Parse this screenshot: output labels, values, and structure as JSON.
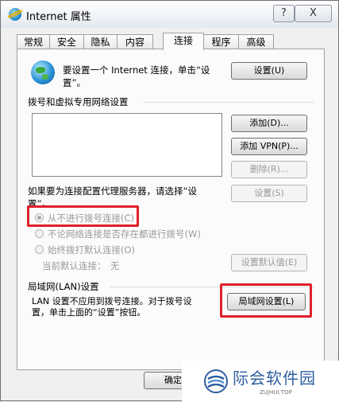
{
  "window": {
    "title": "Internet 属性",
    "help_glyph": "?",
    "close_glyph": "X"
  },
  "tabs": [
    "常规",
    "安全",
    "隐私",
    "内容",
    "连接",
    "程序",
    "高级"
  ],
  "active_tab": "连接",
  "setup": {
    "text_line1": "要设置一个 Internet 连接，单击“设",
    "text_line2": "置”。",
    "button": "设置(U)"
  },
  "dialup": {
    "heading": "拨号和虚拟专用网络设置",
    "list_items": [],
    "add_button": "添加(D)...",
    "add_vpn_button": "添加 VPN(P)...",
    "remove_button": "删除(R)...",
    "proxy_text_line1": "如果要为连接配置代理服务器，请选择“设",
    "proxy_text_line2": "置”。",
    "settings_button": "设置(S)",
    "radio_never": "从不进行拨号连接(C)",
    "radio_when_no_network": "不论网络连接是否存在都进行拨号(W)",
    "radio_always": "始终拨打默认连接(O)",
    "current_default_label": "当前默认连接：",
    "current_default_value": "无",
    "set_default_button": "设置默认值(E)"
  },
  "lan": {
    "heading": "局域网(LAN)设置",
    "text_line1": "LAN 设置不应用到拨号连接。对于拨号设",
    "text_line2": "置，单击上面的“设置”按钮。",
    "button": "局域网设置(L)"
  },
  "footer": {
    "ok_button": "确定"
  },
  "watermark": {
    "name": "际会软件园",
    "sub": "ZUJHUI.TOP"
  },
  "colors": {
    "highlight": "#e0202a",
    "accent": "#2d5e9e"
  }
}
